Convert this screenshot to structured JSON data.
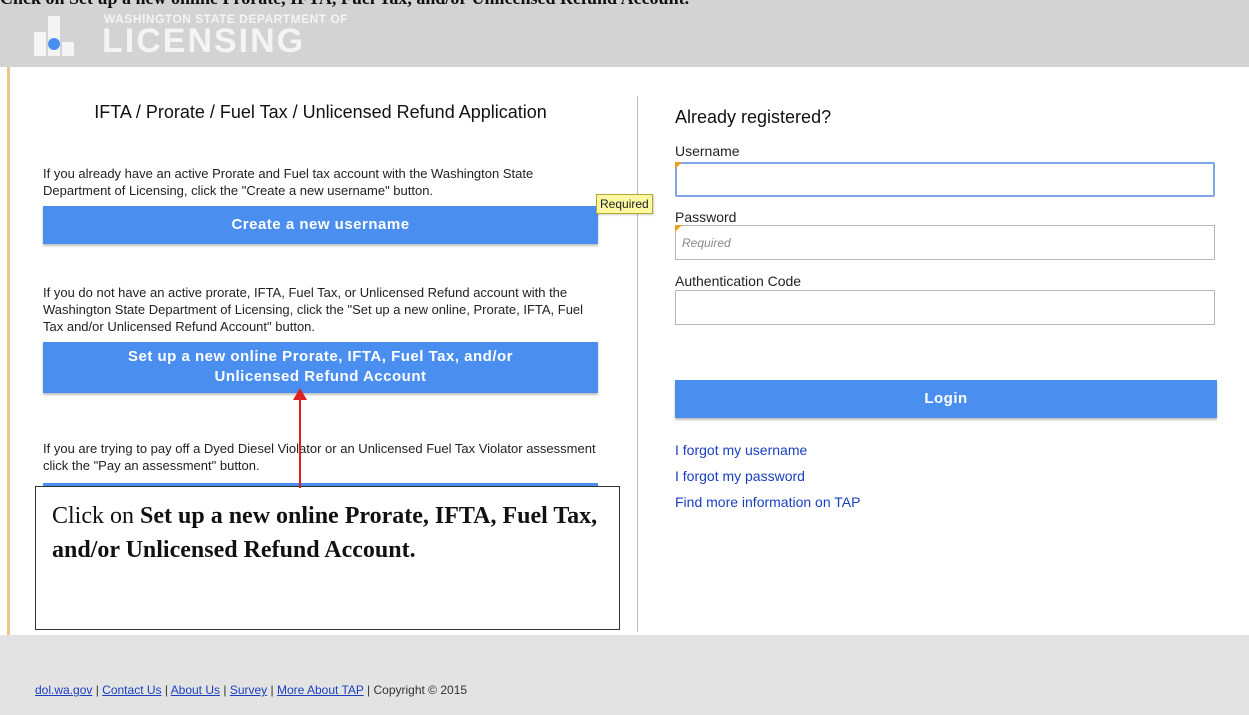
{
  "header": {
    "clipped_instruction": "Click on Set up a new online Prorate, IFTA, Fuel Tax, and/or Unlicensed Refund Account.",
    "logo_small": "WASHINGTON STATE DEPARTMENT OF",
    "logo_big": "LICENSING"
  },
  "left": {
    "title": "IFTA / Prorate / Fuel Tax / Unlicensed Refund Application",
    "para1": "If you already have an active Prorate and Fuel tax account with the Washington State Department of Licensing, click the \"Create a new username\" button.",
    "button1": "Create a new username",
    "para2": "If you do not have an active prorate, IFTA, Fuel Tax, or Unlicensed Refund account with the Washington State Department of Licensing, click the \"Set up a new online, Prorate, IFTA, Fuel Tax and/or Unlicensed Refund Account\" button.",
    "button2_line1": "Set up a new online Prorate, IFTA, Fuel Tax, and/or",
    "button2_line2": "Unlicensed Refund Account",
    "para3": "If you are trying to pay off a Dyed Diesel Violator or an Unlicensed Fuel Tax Violator assessment click the \"Pay an assessment\" button."
  },
  "right": {
    "title": "Already registered?",
    "username_label": "Username",
    "username_value": "",
    "password_label": "Password",
    "password_placeholder": "Required",
    "auth_label": "Authentication Code",
    "auth_value": "",
    "tooltip": "Required",
    "login": "Login",
    "links": [
      "I forgot my username",
      "I forgot my password",
      "Find more information on TAP"
    ]
  },
  "annotation": {
    "prefix": "Click on ",
    "bold": "Set up a new online Prorate, IFTA, Fuel Tax, and/or Unlicensed Refund Account."
  },
  "footer": {
    "links": [
      "dol.wa.gov",
      "Contact Us",
      "About Us",
      "Survey",
      "More About TAP"
    ],
    "copyright": "Copyright © 2015"
  },
  "colors": {
    "button": "#4a8ef0",
    "header": "#d3d3d3",
    "footer": "#e3e3e3",
    "arrow": "#e02020",
    "tooltip": "#fbf7a3"
  }
}
